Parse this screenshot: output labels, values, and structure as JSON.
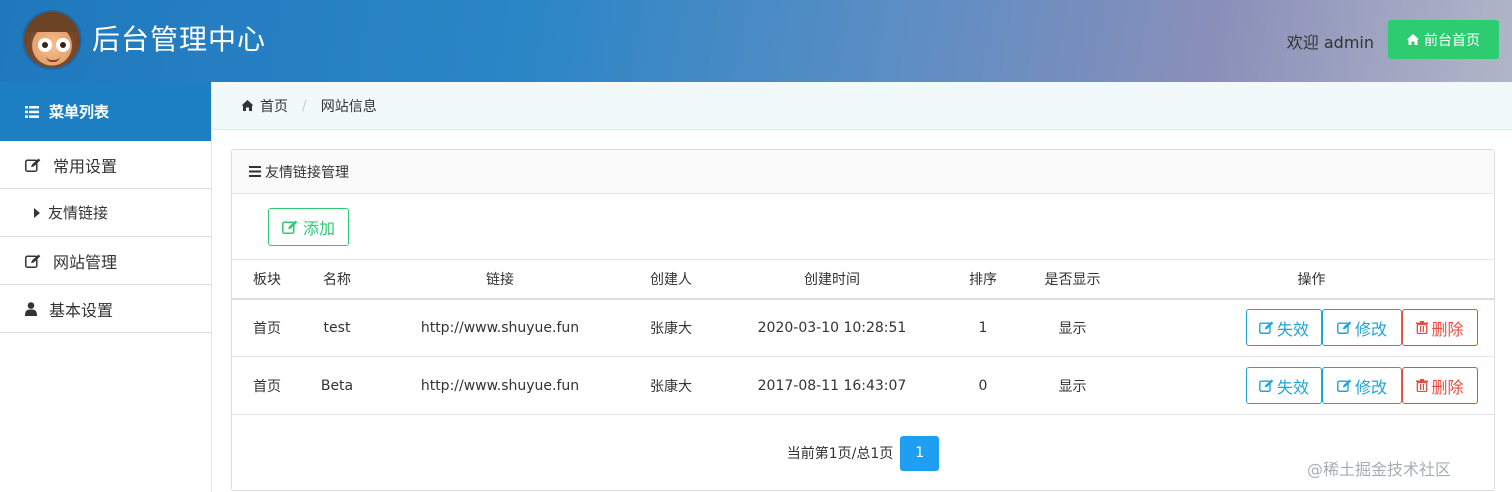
{
  "header": {
    "title": "后台管理中心",
    "welcome": "欢迎 admin",
    "front_button": "前台首页",
    "colors": {
      "accent_green": "#2ecc71",
      "header_blue": "#1f78bd"
    }
  },
  "sidebar": {
    "menu_title": "菜单列表",
    "items": [
      {
        "label": "常用设置",
        "icon": "edit-icon"
      },
      {
        "label": "友情链接",
        "icon": "caret-right-icon"
      },
      {
        "label": "网站管理",
        "icon": "edit-icon"
      },
      {
        "label": "基本设置",
        "icon": "user-icon"
      }
    ]
  },
  "breadcrumb": {
    "home": "首页",
    "current": "网站信息"
  },
  "panel": {
    "title": "友情链接管理",
    "add_label": "添加",
    "columns": [
      "板块",
      "名称",
      "链接",
      "创建人",
      "创建时间",
      "排序",
      "是否显示",
      "操作"
    ],
    "rows": [
      {
        "section": "首页",
        "name": "test",
        "link": "http://www.shuyue.fun",
        "creator": "张康大",
        "created": "2020-03-10 10:28:51",
        "order": "1",
        "visible": "显示"
      },
      {
        "section": "首页",
        "name": "Beta",
        "link": "http://www.shuyue.fun",
        "creator": "张康大",
        "created": "2017-08-11 16:43:07",
        "order": "0",
        "visible": "显示"
      }
    ],
    "actions": {
      "disable": "失效",
      "edit": "修改",
      "delete": "删除"
    },
    "pager": {
      "text": "当前第1页/总1页",
      "current_page": "1"
    }
  },
  "watermark": "@稀土掘金技术社区"
}
